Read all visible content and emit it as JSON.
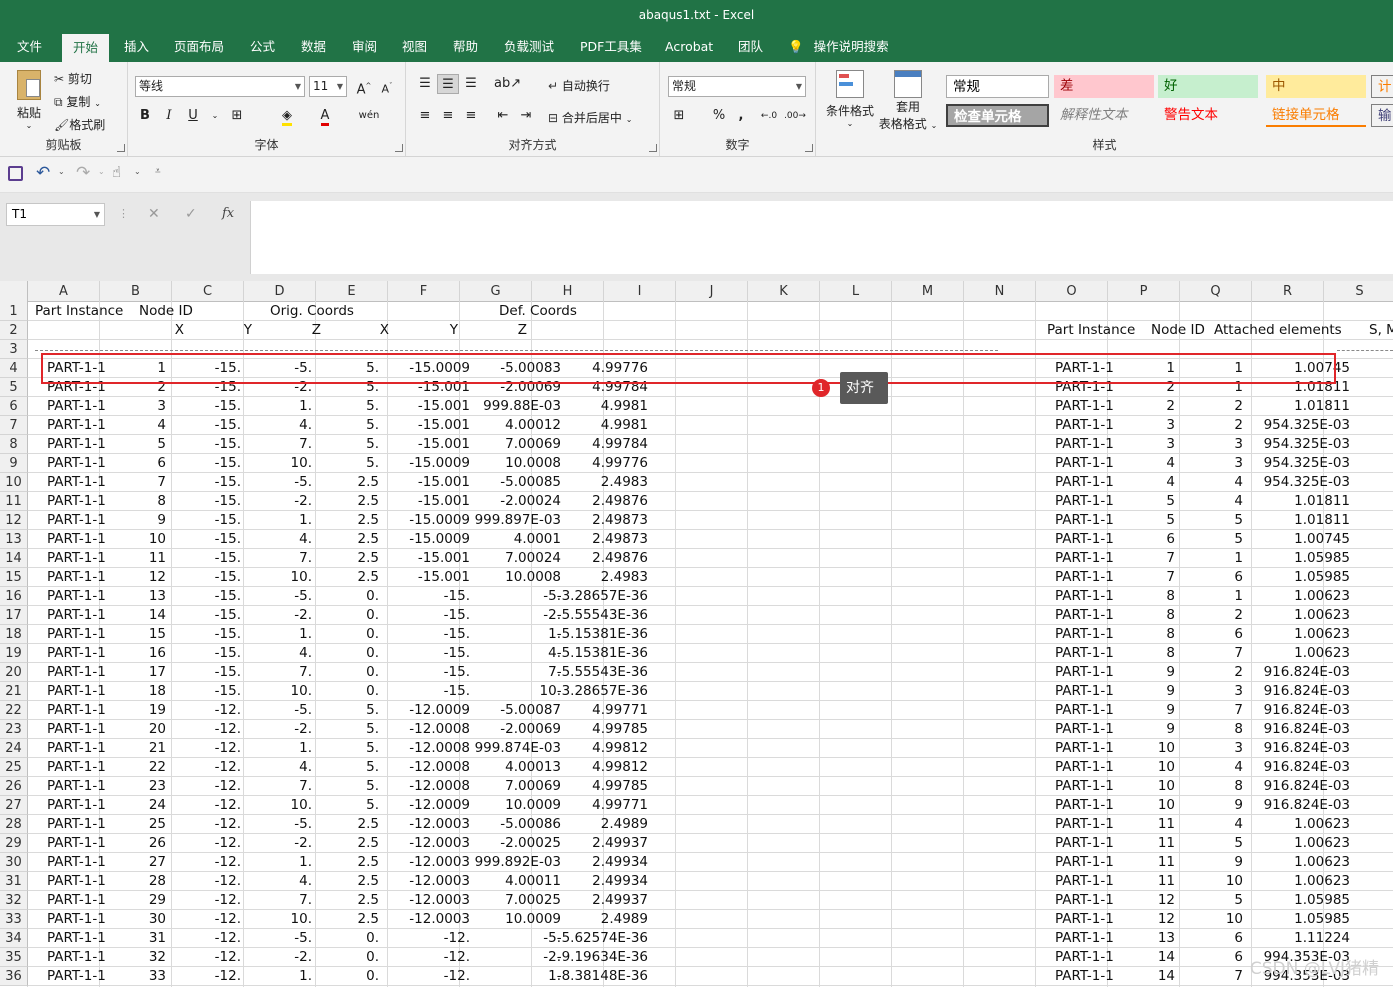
{
  "window": {
    "title": "abaqus1.txt  -  Excel"
  },
  "tabs": [
    "文件",
    "开始",
    "插入",
    "页面布局",
    "公式",
    "数据",
    "审阅",
    "视图",
    "帮助",
    "负载测试",
    "PDF工具集",
    "Acrobat",
    "团队",
    "操作说明搜索"
  ],
  "active_tab": "开始",
  "ribbon": {
    "clipboard": {
      "paste": "粘贴",
      "cut": "剪切",
      "copy": "复制",
      "format_painter": "格式刷",
      "label": "剪贴板"
    },
    "font": {
      "name": "等线",
      "size": "11",
      "bold": "B",
      "italic": "I",
      "underline": "U",
      "grow": "A",
      "shrink": "A",
      "label": "字体"
    },
    "alignment": {
      "wrap": "自动换行",
      "merge": "合并后居中",
      "label": "对齐方式"
    },
    "number": {
      "format": "常规",
      "percent": "%",
      "comma": ",",
      "label": "数字"
    },
    "styles_group": {
      "conditional": "条件格式",
      "table_line1": "套用",
      "table_line2": "表格格式",
      "label": "样式"
    },
    "cell_styles": [
      {
        "text": "常规",
        "bg": "#ffffff",
        "fg": "#000000"
      },
      {
        "text": "差",
        "bg": "#ffc7ce",
        "fg": "#9c0006"
      },
      {
        "text": "好",
        "bg": "#c6efce",
        "fg": "#006100"
      },
      {
        "text": "中",
        "bg": "#ffeb9c",
        "fg": "#9c5700"
      },
      {
        "text": "计算",
        "bg": "#f2f2f2",
        "fg": "#fa7d00"
      },
      {
        "text": "检查单元格",
        "bg": "#a5a5a5",
        "fg": "#ffffff"
      },
      {
        "text": "解释性文本",
        "bg": "#f3f3f3",
        "fg": "#7f7f7f"
      },
      {
        "text": "警告文本",
        "bg": "#f3f3f3",
        "fg": "#ff0000"
      },
      {
        "text": "链接单元格",
        "bg": "#f3f3f3",
        "fg": "#fa7d00"
      },
      {
        "text": "输入",
        "bg": "#f2f2f2",
        "fg": "#3f3f76"
      }
    ]
  },
  "formula_bar": {
    "name_box": "T1",
    "cancel": "✕",
    "enter": "✓",
    "fx": "fx",
    "content": ""
  },
  "columns": [
    "A",
    "B",
    "C",
    "D",
    "E",
    "F",
    "G",
    "H",
    "I",
    "J",
    "K",
    "L",
    "M",
    "N",
    "O",
    "P",
    "Q",
    "R",
    "S"
  ],
  "header_rows": {
    "r1": [
      "Part Instance",
      "Node ID",
      "Orig. Coords",
      "Def. Coords"
    ],
    "r2": [
      "X",
      "Y",
      "Z",
      "X",
      "Y",
      "Z"
    ],
    "r2_right": [
      "Part Instance",
      "Node ID",
      "Attached elements",
      "S, M"
    ]
  },
  "row_numbers": [
    "1",
    "2",
    "3",
    "4",
    "5",
    "6",
    "7",
    "8",
    "9",
    "10",
    "11",
    "12",
    "13",
    "14",
    "15",
    "16",
    "17",
    "18",
    "19",
    "20",
    "21",
    "22",
    "23",
    "24",
    "25",
    "26",
    "27",
    "28",
    "29",
    "30",
    "31",
    "32",
    "33",
    "34",
    "35",
    "36"
  ],
  "left_rows": [
    [
      "PART-1-1",
      "1",
      "-15.",
      "-5.",
      "5.",
      "-15.0009",
      "-5.00083",
      "4.99776"
    ],
    [
      "PART-1-1",
      "2",
      "-15.",
      "-2.",
      "5.",
      "-15.001",
      "-2.00069",
      "4.99784"
    ],
    [
      "PART-1-1",
      "3",
      "-15.",
      "1.",
      "5.",
      "-15.001",
      "999.88E-03",
      "4.9981"
    ],
    [
      "PART-1-1",
      "4",
      "-15.",
      "4.",
      "5.",
      "-15.001",
      "4.00012",
      "4.9981"
    ],
    [
      "PART-1-1",
      "5",
      "-15.",
      "7.",
      "5.",
      "-15.001",
      "7.00069",
      "4.99784"
    ],
    [
      "PART-1-1",
      "6",
      "-15.",
      "10.",
      "5.",
      "-15.0009",
      "10.0008",
      "4.99776"
    ],
    [
      "PART-1-1",
      "7",
      "-15.",
      "-5.",
      "2.5",
      "-15.001",
      "-5.00085",
      "2.4983"
    ],
    [
      "PART-1-1",
      "8",
      "-15.",
      "-2.",
      "2.5",
      "-15.001",
      "-2.00024",
      "2.49876"
    ],
    [
      "PART-1-1",
      "9",
      "-15.",
      "1.",
      "2.5",
      "-15.0009",
      "999.897E-03",
      "2.49873"
    ],
    [
      "PART-1-1",
      "10",
      "-15.",
      "4.",
      "2.5",
      "-15.0009",
      "4.0001",
      "2.49873"
    ],
    [
      "PART-1-1",
      "11",
      "-15.",
      "7.",
      "2.5",
      "-15.001",
      "7.00024",
      "2.49876"
    ],
    [
      "PART-1-1",
      "12",
      "-15.",
      "10.",
      "2.5",
      "-15.001",
      "10.0008",
      "2.4983"
    ],
    [
      "PART-1-1",
      "13",
      "-15.",
      "-5.",
      "0.",
      "-15.",
      "-5.",
      "-3.28657E-36"
    ],
    [
      "PART-1-1",
      "14",
      "-15.",
      "-2.",
      "0.",
      "-15.",
      "-2.",
      "-5.55543E-36"
    ],
    [
      "PART-1-1",
      "15",
      "-15.",
      "1.",
      "0.",
      "-15.",
      "1.",
      "-5.15381E-36"
    ],
    [
      "PART-1-1",
      "16",
      "-15.",
      "4.",
      "0.",
      "-15.",
      "4.",
      "-5.15381E-36"
    ],
    [
      "PART-1-1",
      "17",
      "-15.",
      "7.",
      "0.",
      "-15.",
      "7.",
      "-5.55543E-36"
    ],
    [
      "PART-1-1",
      "18",
      "-15.",
      "10.",
      "0.",
      "-15.",
      "10.",
      "-3.28657E-36"
    ],
    [
      "PART-1-1",
      "19",
      "-12.",
      "-5.",
      "5.",
      "-12.0009",
      "-5.00087",
      "4.99771"
    ],
    [
      "PART-1-1",
      "20",
      "-12.",
      "-2.",
      "5.",
      "-12.0008",
      "-2.00069",
      "4.99785"
    ],
    [
      "PART-1-1",
      "21",
      "-12.",
      "1.",
      "5.",
      "-12.0008",
      "999.874E-03",
      "4.99812"
    ],
    [
      "PART-1-1",
      "22",
      "-12.",
      "4.",
      "5.",
      "-12.0008",
      "4.00013",
      "4.99812"
    ],
    [
      "PART-1-1",
      "23",
      "-12.",
      "7.",
      "5.",
      "-12.0008",
      "7.00069",
      "4.99785"
    ],
    [
      "PART-1-1",
      "24",
      "-12.",
      "10.",
      "5.",
      "-12.0009",
      "10.0009",
      "4.99771"
    ],
    [
      "PART-1-1",
      "25",
      "-12.",
      "-5.",
      "2.5",
      "-12.0003",
      "-5.00086",
      "2.4989"
    ],
    [
      "PART-1-1",
      "26",
      "-12.",
      "-2.",
      "2.5",
      "-12.0003",
      "-2.00025",
      "2.49937"
    ],
    [
      "PART-1-1",
      "27",
      "-12.",
      "1.",
      "2.5",
      "-12.0003",
      "999.892E-03",
      "2.49934"
    ],
    [
      "PART-1-1",
      "28",
      "-12.",
      "4.",
      "2.5",
      "-12.0003",
      "4.00011",
      "2.49934"
    ],
    [
      "PART-1-1",
      "29",
      "-12.",
      "7.",
      "2.5",
      "-12.0003",
      "7.00025",
      "2.49937"
    ],
    [
      "PART-1-1",
      "30",
      "-12.",
      "10.",
      "2.5",
      "-12.0003",
      "10.0009",
      "2.4989"
    ],
    [
      "PART-1-1",
      "31",
      "-12.",
      "-5.",
      "0.",
      "-12.",
      "-5.",
      "-5.62574E-36"
    ],
    [
      "PART-1-1",
      "32",
      "-12.",
      "-2.",
      "0.",
      "-12.",
      "-2.",
      "-9.19634E-36"
    ],
    [
      "PART-1-1",
      "33",
      "-12.",
      "1.",
      "0.",
      "-12.",
      "1.",
      "-8.38148E-36"
    ]
  ],
  "right_rows": [
    [
      "PART-1-1",
      "1",
      "1",
      "1.00745"
    ],
    [
      "PART-1-1",
      "2",
      "1",
      "1.01811"
    ],
    [
      "PART-1-1",
      "2",
      "2",
      "1.01811"
    ],
    [
      "PART-1-1",
      "3",
      "2",
      "954.325E-03"
    ],
    [
      "PART-1-1",
      "3",
      "3",
      "954.325E-03"
    ],
    [
      "PART-1-1",
      "4",
      "3",
      "954.325E-03"
    ],
    [
      "PART-1-1",
      "4",
      "4",
      "954.325E-03"
    ],
    [
      "PART-1-1",
      "5",
      "4",
      "1.01811"
    ],
    [
      "PART-1-1",
      "5",
      "5",
      "1.01811"
    ],
    [
      "PART-1-1",
      "6",
      "5",
      "1.00745"
    ],
    [
      "PART-1-1",
      "7",
      "1",
      "1.05985"
    ],
    [
      "PART-1-1",
      "7",
      "6",
      "1.05985"
    ],
    [
      "PART-1-1",
      "8",
      "1",
      "1.00623"
    ],
    [
      "PART-1-1",
      "8",
      "2",
      "1.00623"
    ],
    [
      "PART-1-1",
      "8",
      "6",
      "1.00623"
    ],
    [
      "PART-1-1",
      "8",
      "7",
      "1.00623"
    ],
    [
      "PART-1-1",
      "9",
      "2",
      "916.824E-03"
    ],
    [
      "PART-1-1",
      "9",
      "3",
      "916.824E-03"
    ],
    [
      "PART-1-1",
      "9",
      "7",
      "916.824E-03"
    ],
    [
      "PART-1-1",
      "9",
      "8",
      "916.824E-03"
    ],
    [
      "PART-1-1",
      "10",
      "3",
      "916.824E-03"
    ],
    [
      "PART-1-1",
      "10",
      "4",
      "916.824E-03"
    ],
    [
      "PART-1-1",
      "10",
      "8",
      "916.824E-03"
    ],
    [
      "PART-1-1",
      "10",
      "9",
      "916.824E-03"
    ],
    [
      "PART-1-1",
      "11",
      "4",
      "1.00623"
    ],
    [
      "PART-1-1",
      "11",
      "5",
      "1.00623"
    ],
    [
      "PART-1-1",
      "11",
      "9",
      "1.00623"
    ],
    [
      "PART-1-1",
      "11",
      "10",
      "1.00623"
    ],
    [
      "PART-1-1",
      "12",
      "5",
      "1.05985"
    ],
    [
      "PART-1-1",
      "12",
      "10",
      "1.05985"
    ],
    [
      "PART-1-1",
      "13",
      "6",
      "1.11224"
    ],
    [
      "PART-1-1",
      "14",
      "6",
      "994.353E-03"
    ],
    [
      "PART-1-1",
      "14",
      "7",
      "994.353E-03"
    ]
  ],
  "annotation": {
    "number": "1",
    "text": "对齐",
    "highlight_color": "#e0262a"
  },
  "watermark": "CSDN @LVJ猪精"
}
